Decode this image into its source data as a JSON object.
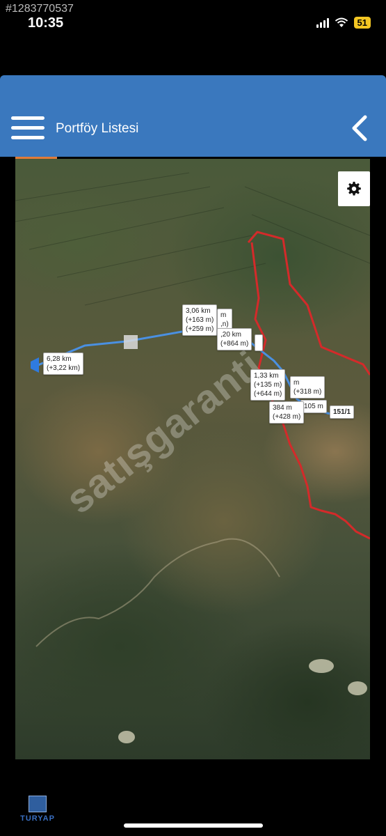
{
  "overlay_id": "#1283770537",
  "status_bar": {
    "time": "10:35",
    "battery": "51"
  },
  "app_bar": {
    "title": "Portföy Listesi",
    "menu_icon": "hamburger-menu-icon",
    "back_icon": "chevron-left-icon"
  },
  "map": {
    "watermark": "satışgaranti",
    "settings_icon": "gear-icon",
    "labels": [
      {
        "text": "6,28 km"
      },
      {
        "text": "(+3,22 km)"
      },
      {
        "text": "3,06 km"
      },
      {
        "text": "(+163 m)"
      },
      {
        "text": "m"
      },
      {
        "text": "(+259 m)"
      },
      {
        "text": ",n)"
      },
      {
        "text": ",20 km"
      },
      {
        "text": "(+864 m)"
      },
      {
        "text": "1,33 km"
      },
      {
        "text": "(+135 m)"
      },
      {
        "text": "(+644 m)"
      },
      {
        "text": "m"
      },
      {
        "text": "(+318 m)"
      },
      {
        "text": "105 m"
      },
      {
        "text": "384 m"
      },
      {
        "text": "(+428 m)"
      },
      {
        "text": "151/1"
      }
    ]
  },
  "footer": {
    "logo_text": "TURYAP"
  },
  "colors": {
    "app_bar": "#3a78be",
    "route": "#4a90e2",
    "boundary": "#d42a2a"
  }
}
